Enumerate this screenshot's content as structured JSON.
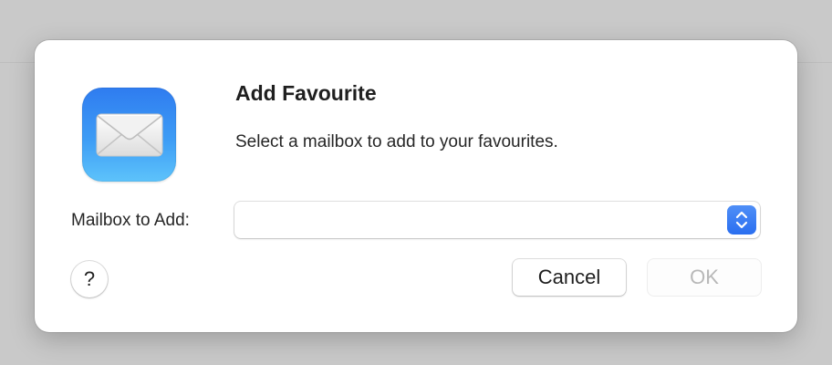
{
  "dialog": {
    "title": "Add Favourite",
    "message": "Select a mailbox to add to your favourites.",
    "app_icon": "mail-envelope-icon",
    "field": {
      "label": "Mailbox to Add:",
      "value": "",
      "control_icon": "up-down-chevron-icon"
    },
    "help_label": "?",
    "buttons": {
      "cancel_label": "Cancel",
      "ok_label": "OK",
      "ok_enabled": false
    }
  },
  "colors": {
    "accent": "#2f7cf0",
    "disabled_text": "#b8b8b8",
    "backdrop": "#c9c9c9"
  }
}
